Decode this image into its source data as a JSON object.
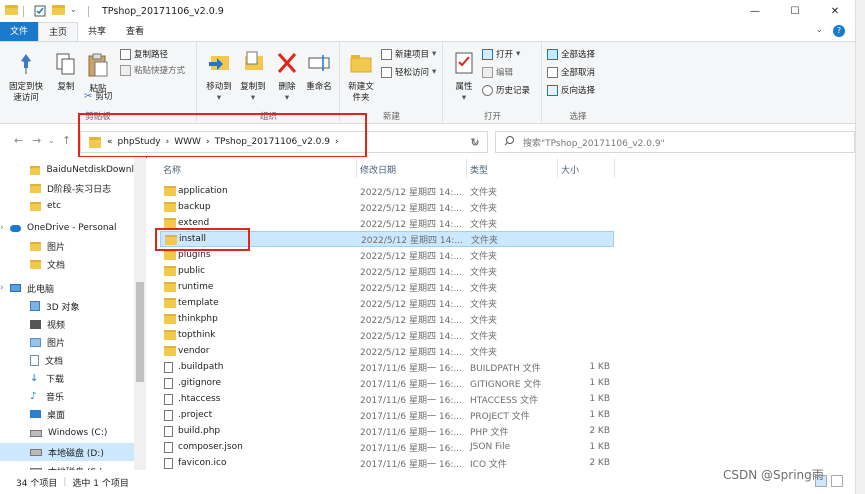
{
  "window": {
    "title": "TPshop_20171106_v2.0.9",
    "controls": {
      "minimize": "—",
      "maximize": "☐",
      "close": "✕"
    }
  },
  "tabs": {
    "file": "文件",
    "home": "主页",
    "share": "共享",
    "view": "查看"
  },
  "ribbon": {
    "clipboard": {
      "pin": "固定到快速访问",
      "copy": "复制",
      "paste": "粘贴",
      "copy_path": "复制路径",
      "paste_shortcut": "粘贴快捷方式",
      "cut": "剪切",
      "label": "剪贴板"
    },
    "organize": {
      "move_to": "移动到",
      "copy_to": "复制到",
      "delete": "删除",
      "rename": "重命名",
      "label": "组织"
    },
    "new": {
      "new_folder": "新建文件夹",
      "new_item": "新建项目",
      "easy_access": "轻松访问",
      "label": "新建"
    },
    "open": {
      "properties": "属性",
      "open": "打开",
      "edit": "编辑",
      "history": "历史记录",
      "label": "打开"
    },
    "select": {
      "select_all": "全部选择",
      "select_none": "全部取消",
      "invert": "反向选择",
      "label": "选择"
    }
  },
  "address": {
    "prefix": "«",
    "crumbs": [
      "phpStudy",
      "WWW",
      "TPshop_20171106_v2.0.9"
    ],
    "search_placeholder": "搜索\"TPshop_20171106_v2.0.9\""
  },
  "navpane": {
    "items": [
      {
        "label": "BaiduNetdiskDownl",
        "icon": "folder-icon"
      },
      {
        "label": "D阶段-实习日志",
        "icon": "folder-icon"
      },
      {
        "label": "etc",
        "icon": "folder-icon"
      },
      {
        "label": "OneDrive - Personal",
        "icon": "cloud-icon"
      },
      {
        "label": "图片",
        "icon": "folder-icon"
      },
      {
        "label": "文档",
        "icon": "folder-icon"
      },
      {
        "label": "此电脑",
        "icon": "computer-icon"
      },
      {
        "label": "3D 对象",
        "icon": "cube-icon"
      },
      {
        "label": "视频",
        "icon": "video-icon"
      },
      {
        "label": "图片",
        "icon": "picture-icon"
      },
      {
        "label": "文档",
        "icon": "document-icon"
      },
      {
        "label": "下载",
        "icon": "download-icon"
      },
      {
        "label": "音乐",
        "icon": "music-icon"
      },
      {
        "label": "桌面",
        "icon": "desktop-icon"
      },
      {
        "label": "Windows (C:)",
        "icon": "drive-icon"
      },
      {
        "label": "本地磁盘 (D:)",
        "icon": "drive-icon"
      },
      {
        "label": "本地磁盘 (E:)",
        "icon": "drive-icon"
      }
    ]
  },
  "columns": {
    "name": "名称",
    "date": "修改日期",
    "type": "类型",
    "size": "大小"
  },
  "files": [
    {
      "name": "application",
      "date": "2022/5/12 星期四 14:...",
      "type": "文件夹",
      "size": "",
      "kind": "folder"
    },
    {
      "name": "backup",
      "date": "2022/5/12 星期四 14:...",
      "type": "文件夹",
      "size": "",
      "kind": "folder"
    },
    {
      "name": "extend",
      "date": "2022/5/12 星期四 14:...",
      "type": "文件夹",
      "size": "",
      "kind": "folder"
    },
    {
      "name": "install",
      "date": "2022/5/12 星期四 14:...",
      "type": "文件夹",
      "size": "",
      "kind": "folder",
      "selected": true
    },
    {
      "name": "plugins",
      "date": "2022/5/12 星期四 14:...",
      "type": "文件夹",
      "size": "",
      "kind": "folder"
    },
    {
      "name": "public",
      "date": "2022/5/12 星期四 14:...",
      "type": "文件夹",
      "size": "",
      "kind": "folder"
    },
    {
      "name": "runtime",
      "date": "2022/5/12 星期四 14:...",
      "type": "文件夹",
      "size": "",
      "kind": "folder"
    },
    {
      "name": "template",
      "date": "2022/5/12 星期四 14:...",
      "type": "文件夹",
      "size": "",
      "kind": "folder"
    },
    {
      "name": "thinkphp",
      "date": "2022/5/12 星期四 14:...",
      "type": "文件夹",
      "size": "",
      "kind": "folder"
    },
    {
      "name": "topthink",
      "date": "2022/5/12 星期四 14:...",
      "type": "文件夹",
      "size": "",
      "kind": "folder"
    },
    {
      "name": "vendor",
      "date": "2022/5/12 星期四 14:...",
      "type": "文件夹",
      "size": "",
      "kind": "folder"
    },
    {
      "name": ".buildpath",
      "date": "2017/11/6 星期一 16:...",
      "type": "BUILDPATH 文件",
      "size": "1 KB",
      "kind": "file"
    },
    {
      "name": ".gitignore",
      "date": "2017/11/6 星期一 16:...",
      "type": "GITIGNORE 文件",
      "size": "1 KB",
      "kind": "file"
    },
    {
      "name": ".htaccess",
      "date": "2017/11/6 星期一 16:...",
      "type": "HTACCESS 文件",
      "size": "1 KB",
      "kind": "file"
    },
    {
      "name": ".project",
      "date": "2017/11/6 星期一 16:...",
      "type": "PROJECT 文件",
      "size": "1 KB",
      "kind": "file"
    },
    {
      "name": "build.php",
      "date": "2017/11/6 星期一 16:...",
      "type": "PHP 文件",
      "size": "2 KB",
      "kind": "file"
    },
    {
      "name": "composer.json",
      "date": "2017/11/6 星期一 16:...",
      "type": "JSON File",
      "size": "1 KB",
      "kind": "file"
    },
    {
      "name": "favicon.ico",
      "date": "2017/11/6 星期一 16:...",
      "type": "ICO 文件",
      "size": "2 KB",
      "kind": "file"
    }
  ],
  "status": {
    "count": "34 个项目",
    "selected": "选中 1 个项目"
  },
  "watermark": "CSDN @Spring雨",
  "colors": {
    "accent": "#1979ca",
    "selection": "#cce8ff",
    "highlight": "#e0251b",
    "folder": "#f2c94c"
  }
}
